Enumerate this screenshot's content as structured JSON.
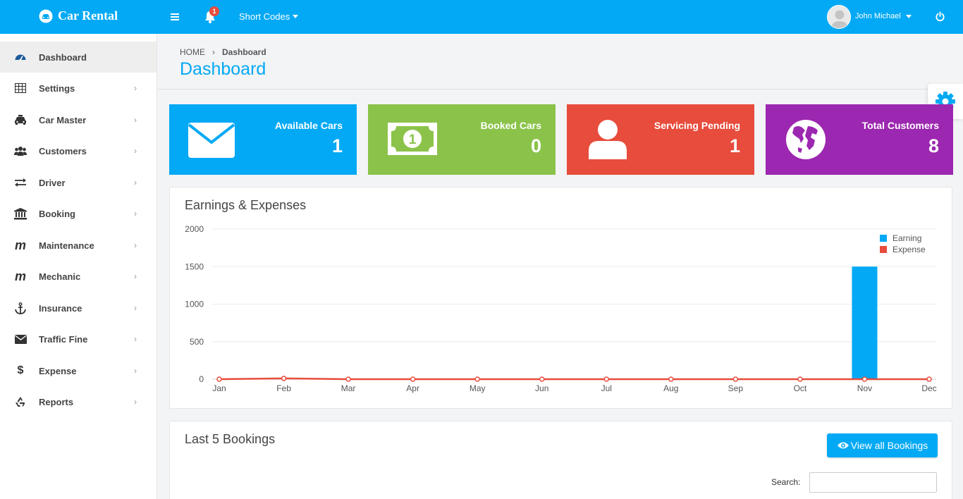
{
  "topbar": {
    "brand": "Car Rental",
    "notification_count": "1",
    "short_codes": "Short Codes",
    "username": "John Michael"
  },
  "sidebar": {
    "items": [
      {
        "label": "Dashboard",
        "icon": "dashboard-icon"
      },
      {
        "label": "Settings",
        "icon": "table-icon"
      },
      {
        "label": "Car Master",
        "icon": "taxi-icon"
      },
      {
        "label": "Customers",
        "icon": "users-icon"
      },
      {
        "label": "Driver",
        "icon": "exchange-icon"
      },
      {
        "label": "Booking",
        "icon": "bank-icon"
      },
      {
        "label": "Maintenance",
        "icon": "m-icon"
      },
      {
        "label": "Mechanic",
        "icon": "m-icon"
      },
      {
        "label": "Insurance",
        "icon": "anchor-icon"
      },
      {
        "label": "Traffic Fine",
        "icon": "envelope-icon"
      },
      {
        "label": "Expense",
        "icon": "dollar-icon"
      },
      {
        "label": "Reports",
        "icon": "recycle-icon"
      }
    ]
  },
  "header": {
    "breadcrumb_home": "HOME",
    "breadcrumb_current": "Dashboard",
    "title": "Dashboard"
  },
  "cards": [
    {
      "label": "Available Cars",
      "value": "1",
      "color": "#03a9f4",
      "icon": "envelope-icon"
    },
    {
      "label": "Booked Cars",
      "value": "0",
      "color": "#8bc34a",
      "icon": "money-icon"
    },
    {
      "label": "Servicing Pending",
      "value": "1",
      "color": "#e74c3c",
      "icon": "user-icon"
    },
    {
      "label": "Total Customers",
      "value": "8",
      "color": "#9c27b0",
      "icon": "globe-icon"
    }
  ],
  "earnings": {
    "title": "Earnings & Expenses"
  },
  "chart_data": {
    "type": "bar",
    "categories": [
      "Jan",
      "Feb",
      "Mar",
      "Apr",
      "May",
      "Jun",
      "Jul",
      "Aug",
      "Sep",
      "Oct",
      "Nov",
      "Dec"
    ],
    "series": [
      {
        "name": "Earning",
        "type": "bar",
        "color": "#03a9f4",
        "values": [
          0,
          0,
          0,
          0,
          0,
          0,
          0,
          0,
          0,
          0,
          1500,
          0
        ]
      },
      {
        "name": "Expense",
        "type": "line",
        "color": "#e74c3c",
        "values": [
          0,
          10,
          0,
          0,
          0,
          0,
          0,
          0,
          0,
          0,
          0,
          0
        ]
      }
    ],
    "yticks": [
      0,
      500,
      1000,
      1500,
      2000
    ],
    "ylim": [
      0,
      2000
    ],
    "grid": true,
    "legend": "top-right"
  },
  "bookings": {
    "title": "Last 5 Bookings",
    "view_all_label": "View all Bookings",
    "search_label": "Search:",
    "search_value": ""
  }
}
